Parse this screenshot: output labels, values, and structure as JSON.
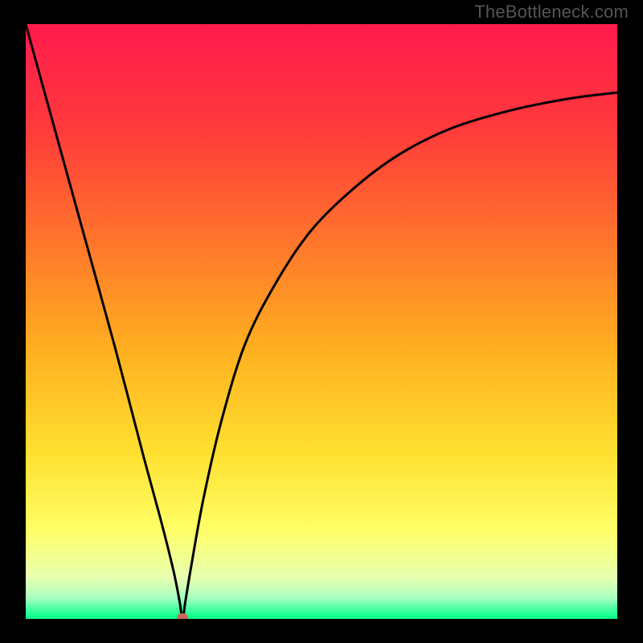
{
  "attribution": "TheBottleneck.com",
  "chart_data": {
    "type": "line",
    "title": "",
    "xlabel": "",
    "ylabel": "",
    "xlim": [
      0,
      100
    ],
    "ylim": [
      0,
      100
    ],
    "grid": false,
    "legend": false,
    "background_gradient": {
      "stops": [
        {
          "pos": 0.0,
          "color": "#ff1a4d"
        },
        {
          "pos": 0.18,
          "color": "#ff3b3b"
        },
        {
          "pos": 0.38,
          "color": "#ff7a2a"
        },
        {
          "pos": 0.55,
          "color": "#ffb020"
        },
        {
          "pos": 0.72,
          "color": "#ffe030"
        },
        {
          "pos": 0.85,
          "color": "#ffff66"
        },
        {
          "pos": 0.93,
          "color": "#e8ffb0"
        },
        {
          "pos": 0.965,
          "color": "#a8ffc0"
        },
        {
          "pos": 0.985,
          "color": "#40ffa0"
        },
        {
          "pos": 1.0,
          "color": "#00ff88"
        }
      ]
    },
    "curve": {
      "x": [
        0,
        5,
        10,
        15,
        20,
        23,
        25,
        26,
        26.5,
        27,
        28,
        30,
        33,
        37,
        42,
        48,
        55,
        63,
        72,
        82,
        92,
        100
      ],
      "y": [
        100,
        82,
        64,
        46,
        27,
        16,
        8,
        3,
        0,
        3,
        9,
        20,
        33,
        46,
        56,
        65,
        72,
        78,
        82.5,
        85.5,
        87.5,
        88.5
      ]
    },
    "marker": {
      "x": 26.5,
      "y": 0,
      "color": "#c86a5a"
    }
  }
}
